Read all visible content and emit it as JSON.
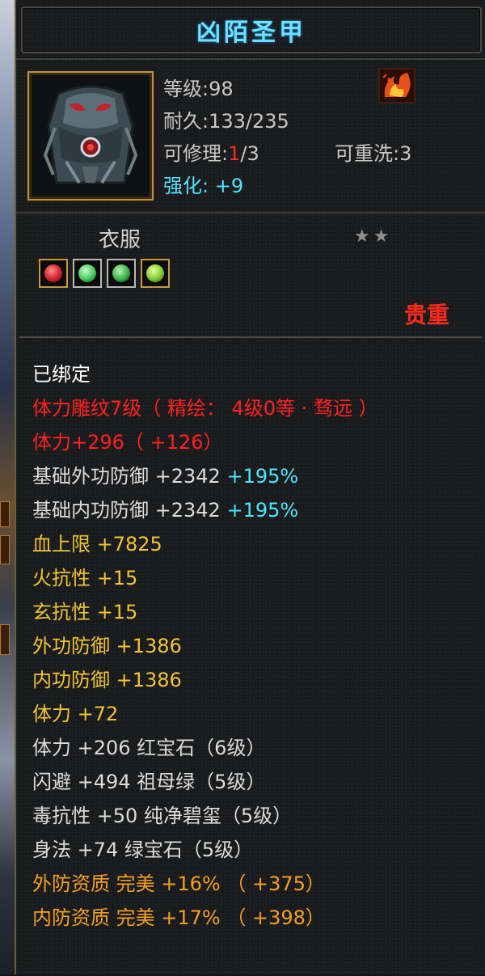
{
  "title": "凶陌圣甲",
  "item": {
    "level_label": "等级",
    "level_value": ":98",
    "durability_label": "耐久",
    "durability_value": ":133/235",
    "repair_label": "可修理:",
    "repair_used": "1",
    "repair_total": "/3",
    "rewash_label": "可重洗",
    "rewash_value": ":3",
    "enhance_label": "强化:",
    "enhance_value": "+9",
    "slot": "衣服",
    "stars": "★★",
    "rarity": "贵重"
  },
  "gems": [
    {
      "name": "red-gem-icon",
      "color": "#d0202a",
      "border": "#c49a3a"
    },
    {
      "name": "green-gem-icon",
      "color": "#44c85a",
      "border": "#b8b8b8"
    },
    {
      "name": "green-gem-icon",
      "color": "#3ab04c",
      "border": "#b8b8b8"
    },
    {
      "name": "green-gem-icon",
      "color": "#7ecb2e",
      "border": "#c49a3a"
    }
  ],
  "attributes": {
    "bound": "已绑定",
    "engrave": "体力雕纹7级（ 精绘： 4级0等 · 骛远 ）",
    "stamina_main": "体力+296（ +126）",
    "base_ext_def": "基础外功防御  +2342",
    "base_ext_def_pct": "+195%",
    "base_int_def": "基础内功防御  +2342",
    "base_int_def_pct": "+195%",
    "hp_max": "血上限  +7825",
    "fire_res": "火抗性  +15",
    "mystic_res": "玄抗性  +15",
    "ext_def": "外功防御  +1386",
    "int_def": "内功防御  +1386",
    "stamina_bonus": "体力  +72",
    "gem_line_1": "体力  +206  红宝石（6级）",
    "gem_line_2": "闪避  +494  祖母绿（5级）",
    "gem_line_3": "毒抗性  +50  纯净碧玺（5级）",
    "gem_line_4": "身法  +74  绿宝石（5级）",
    "ext_quality": "外防资质    完美  +16%  （ +375）",
    "int_quality": "内防资质    完美  +17%  （ +398）"
  },
  "colors": {
    "title": "#6fe0ff",
    "bound": "#ffffff",
    "engrave": "#ff2020",
    "base_attr": "#f0c531",
    "percent": "#46e8ff",
    "quality": "#f3a020",
    "rarity": "#ff2a1a"
  }
}
